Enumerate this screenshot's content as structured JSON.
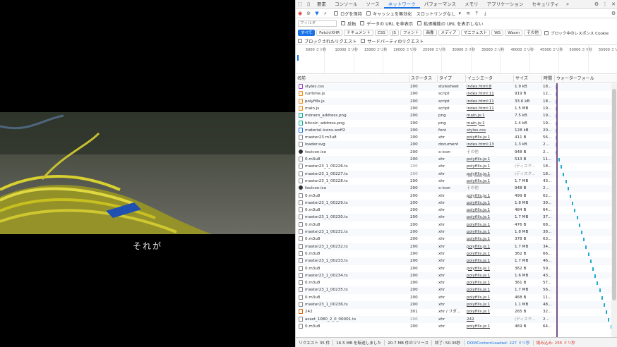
{
  "video": {
    "subtitle": "それが"
  },
  "devtools": {
    "tabs": [
      "要素",
      "コンソール",
      "ソース",
      "ネットワーク",
      "パフォーマンス",
      "メモリ",
      "アプリケーション",
      "セキュリティ"
    ],
    "selected_tab": "ネットワーク",
    "toolbar": {
      "preserve_log": "ログを保持",
      "disable_cache": "キャッシュを無効化",
      "throttle": "スロットリングなし"
    },
    "filter": {
      "placeholder": "フィルタ",
      "invert": "反転",
      "hide_data_urls": "データの URL を非表示",
      "hide_ext_urls": "拡張機能の URL を表示しない"
    },
    "type_chips": [
      "すべて",
      "Fetch/XHR",
      "ドキュメント",
      "CSS",
      "JS",
      "フォント",
      "画像",
      "メディア",
      "マニフェスト",
      "WS",
      "Wasm",
      "その他"
    ],
    "blocked_cookies": "ブロック中のレスポンス Cookie",
    "blocked_requests": "ブロックされたリクエスト",
    "third_party": "サードパーティのリクエスト",
    "timeline_ticks": [
      "5000 ミリ秒",
      "10000 ミリ秒",
      "15000 ミリ秒",
      "20000 ミリ秒",
      "25000 ミリ秒",
      "30000 ミリ秒",
      "35000 ミリ秒",
      "40000 ミリ秒",
      "45000 ミリ秒",
      "50000 ミリ秒",
      "55000 ミリ秒"
    ],
    "columns": [
      "名前",
      "ステータス",
      "タイプ",
      "イニシエータ",
      "サイズ",
      "時間",
      "ウォーターフォール"
    ],
    "rows": [
      {
        "icon": "css",
        "name": "styles.css",
        "status": "200",
        "type": "stylesheet",
        "init": "index.html:8",
        "size": "1.9 kB",
        "time": "18..."
      },
      {
        "icon": "js",
        "name": "runtime.js",
        "status": "200",
        "type": "script",
        "init": "index.html:11",
        "size": "919 B",
        "time": "12..."
      },
      {
        "icon": "js",
        "name": "polyfills.js",
        "status": "200",
        "type": "script",
        "init": "index.html:11",
        "size": "33.6 kB",
        "time": "18..."
      },
      {
        "icon": "js",
        "name": "main.js",
        "status": "200",
        "type": "script",
        "init": "index.html:11",
        "size": "1.5 MB",
        "time": "19..."
      },
      {
        "icon": "img",
        "name": "monero_address.png",
        "status": "200",
        "type": "png",
        "init": "main.js:1",
        "size": "7.5 kB",
        "time": "19..."
      },
      {
        "icon": "img",
        "name": "bitcoin_address.png",
        "status": "200",
        "type": "png",
        "init": "main.js:1",
        "size": "1.4 kB",
        "time": "19..."
      },
      {
        "icon": "font",
        "name": "material-icons.woff2",
        "status": "200",
        "type": "font",
        "init": "styles.css",
        "size": "128 kB",
        "time": "20..."
      },
      {
        "icon": "doc",
        "name": "master23.m3u8",
        "status": "200",
        "type": "xhr",
        "init": "polyfills.js:1",
        "size": "411 B",
        "time": "56..."
      },
      {
        "icon": "doc",
        "name": "loader.svg",
        "status": "200",
        "type": "document",
        "init": "index.html:13",
        "size": "1.3 kB",
        "time": "2..."
      },
      {
        "icon": "circle",
        "name": "favicon.ico",
        "status": "200",
        "type": "x-icon",
        "init": "その他",
        "size": "948 B",
        "time": "2..."
      },
      {
        "icon": "doc",
        "name": "0.m3u8",
        "status": "200",
        "type": "xhr",
        "init": "polyfills.js:1",
        "size": "513 B",
        "time": "11..."
      },
      {
        "icon": "doc",
        "name": "master23_1_00226.ts",
        "status": "200",
        "type": "xhr",
        "init": "polyfills.js:1",
        "size": "(ディスク...",
        "time": "18..."
      },
      {
        "icon": "doc",
        "name": "master23_1_00227.ts",
        "status": "200",
        "type": "xhr",
        "init": "polyfills.js:1",
        "size": "(ディスク...",
        "time": "18..."
      },
      {
        "icon": "doc",
        "name": "master23_1_00228.ts",
        "status": "200",
        "type": "xhr",
        "init": "polyfills.js:1",
        "size": "1.7 MB",
        "time": "43..."
      },
      {
        "icon": "circle",
        "name": "favicon.ico",
        "status": "200",
        "type": "x-icon",
        "init": "その他",
        "size": "948 B",
        "time": "2..."
      },
      {
        "icon": "doc",
        "name": "0.m3u8",
        "status": "200",
        "type": "xhr",
        "init": "polyfills.js:1",
        "size": "499 B",
        "time": "62..."
      },
      {
        "icon": "doc",
        "name": "master23_1_00229.ts",
        "status": "200",
        "type": "xhr",
        "init": "polyfills.js:1",
        "size": "1.8 MB",
        "time": "39..."
      },
      {
        "icon": "doc",
        "name": "0.m3u8",
        "status": "200",
        "type": "xhr",
        "init": "polyfills.js:1",
        "size": "484 B",
        "time": "64..."
      },
      {
        "icon": "doc",
        "name": "master23_1_00230.ts",
        "status": "200",
        "type": "xhr",
        "init": "polyfills.js:1",
        "size": "1.7 MB",
        "time": "37..."
      },
      {
        "icon": "doc",
        "name": "0.m3u8",
        "status": "200",
        "type": "xhr",
        "init": "polyfills.js:1",
        "size": "476 B",
        "time": "68..."
      },
      {
        "icon": "doc",
        "name": "master23_1_00231.ts",
        "status": "200",
        "type": "xhr",
        "init": "polyfills.js:1",
        "size": "1.8 MB",
        "time": "38..."
      },
      {
        "icon": "doc",
        "name": "0.m3u8",
        "status": "200",
        "type": "xhr",
        "init": "polyfills.js:1",
        "size": "378 B",
        "time": "63..."
      },
      {
        "icon": "doc",
        "name": "master23_1_00232.ts",
        "status": "200",
        "type": "xhr",
        "init": "polyfills.js:1",
        "size": "1.7 MB",
        "time": "34..."
      },
      {
        "icon": "doc",
        "name": "0.m3u8",
        "status": "200",
        "type": "xhr",
        "init": "polyfills.js:1",
        "size": "362 B",
        "time": "66..."
      },
      {
        "icon": "doc",
        "name": "master23_1_00233.ts",
        "status": "200",
        "type": "xhr",
        "init": "polyfills.js:1",
        "size": "1.7 MB",
        "time": "46..."
      },
      {
        "icon": "doc",
        "name": "0.m3u8",
        "status": "200",
        "type": "xhr",
        "init": "polyfills.js:1",
        "size": "362 B",
        "time": "59..."
      },
      {
        "icon": "doc",
        "name": "master23_1_00234.ts",
        "status": "200",
        "type": "xhr",
        "init": "polyfills.js:1",
        "size": "1.6 MB",
        "time": "43..."
      },
      {
        "icon": "doc",
        "name": "0.m3u8",
        "status": "200",
        "type": "xhr",
        "init": "polyfills.js:1",
        "size": "361 B",
        "time": "57..."
      },
      {
        "icon": "doc",
        "name": "master23_1_00235.ts",
        "status": "200",
        "type": "xhr",
        "init": "polyfills.js:1",
        "size": "1.7 MB",
        "time": "56..."
      },
      {
        "icon": "doc",
        "name": "0.m3u8",
        "status": "200",
        "type": "xhr",
        "init": "polyfills.js:1",
        "size": "468 B",
        "time": "11..."
      },
      {
        "icon": "doc",
        "name": "master23_1_00236.ts",
        "status": "200",
        "type": "xhr",
        "init": "polyfills.js:1",
        "size": "1.1 MB",
        "time": "48..."
      },
      {
        "icon": "redirect",
        "name": "242",
        "status": "301",
        "type": "xhr / リダ...",
        "init": "polyfills.js:1",
        "size": "265 B",
        "time": "32..."
      },
      {
        "icon": "doc",
        "name": "asset_1080_2_0_00001.ts",
        "status": "200",
        "type": "xhr",
        "init": "242",
        "size": "(ディスク...",
        "time": "2..."
      },
      {
        "icon": "doc",
        "name": "0.m3u8",
        "status": "200",
        "type": "xhr",
        "init": "polyfills.js:1",
        "size": "469 B",
        "time": "64..."
      }
    ],
    "status_bar": [
      "リクエスト 35 件",
      "16.5 MB を転送しました",
      "20.7 MB 件のリソース",
      "終了: 50.36秒",
      "DOMContentLoaded: 227 ミリ秒",
      "読み込み: 255 ミリ秒"
    ],
    "colors": {
      "accent": "#1a73e8",
      "dcl": "#1a73e8",
      "load": "#d93025",
      "waterfall": "#22aacc"
    }
  }
}
